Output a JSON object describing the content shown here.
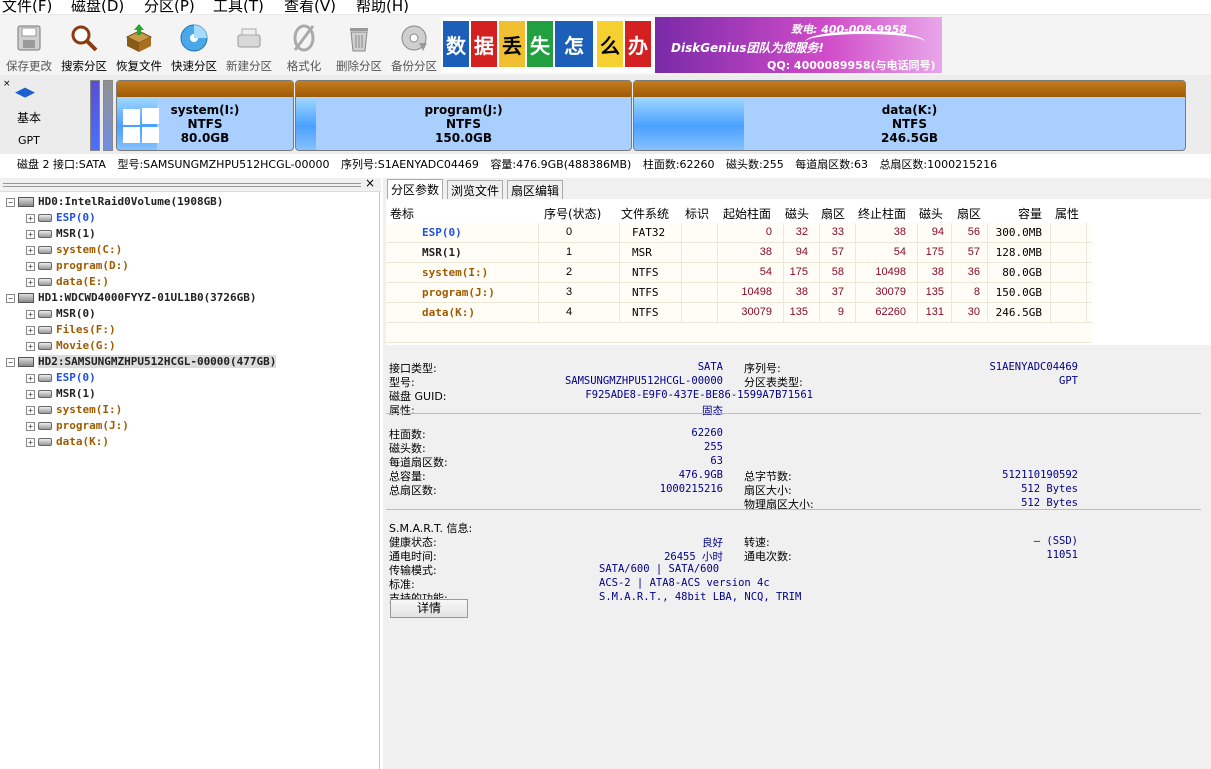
{
  "menu": [
    "文件(F)",
    "磁盘(D)",
    "分区(P)",
    "工具(T)",
    "查看(V)",
    "帮助(H)"
  ],
  "toolbar": [
    {
      "label": "保存更改",
      "icon": "save-disk-icon",
      "enabled": false
    },
    {
      "label": "搜索分区",
      "icon": "magnifier-icon",
      "enabled": true
    },
    {
      "label": "恢复文件",
      "icon": "recover-box-icon",
      "enabled": true
    },
    {
      "label": "快速分区",
      "icon": "quick-partition-disc-icon",
      "enabled": true
    },
    {
      "label": "新建分区",
      "icon": "new-partition-icon",
      "enabled": false
    },
    {
      "label": "格式化",
      "icon": "format-icon",
      "enabled": false
    },
    {
      "label": "删除分区",
      "icon": "trash-icon",
      "enabled": false
    },
    {
      "label": "备份分区",
      "icon": "backup-disc-icon",
      "enabled": false
    }
  ],
  "banner": {
    "tiles": [
      "数",
      "据",
      "丢",
      "失",
      "怎",
      "么",
      "办"
    ],
    "brand": "DiskGenius团队为您服务!",
    "tel": "致电: 400-008-9958",
    "qq": "QQ: 4000089958(与电话同号)"
  },
  "diskmap": {
    "mode": "基本",
    "table": "GPT",
    "partitions": [
      {
        "name": "system(I:)",
        "fs": "NTFS",
        "size": "80.0GB",
        "fill": 0.23
      },
      {
        "name": "program(J:)",
        "fs": "NTFS",
        "size": "150.0GB",
        "fill": 0.06
      },
      {
        "name": "data(K:)",
        "fs": "NTFS",
        "size": "246.5GB",
        "fill": 0.2
      }
    ],
    "info": [
      "磁盘 2 接口:SATA",
      "型号:SAMSUNGMZHPU512HCGL-00000",
      "序列号:S1AENYADC04469",
      "容量:476.9GB(488386MB)",
      "柱面数:62260",
      "磁头数:255",
      "每道扇区数:63",
      "总扇区数:1000215216"
    ]
  },
  "tree": [
    {
      "level": 0,
      "text": "HD0:IntelRaid0Volume(1908GB)",
      "color": "black"
    },
    {
      "level": 1,
      "text": "ESP(0)",
      "color": "blue"
    },
    {
      "level": 1,
      "text": "MSR(1)",
      "color": "black"
    },
    {
      "level": 1,
      "text": "system(C:)",
      "color": "brown"
    },
    {
      "level": 1,
      "text": "program(D:)",
      "color": "brown"
    },
    {
      "level": 1,
      "text": "data(E:)",
      "color": "brown"
    },
    {
      "level": 0,
      "text": "HD1:WDCWD4000FYYZ-01UL1B0(3726GB)",
      "color": "black"
    },
    {
      "level": 1,
      "text": "MSR(0)",
      "color": "black"
    },
    {
      "level": 1,
      "text": "Files(F:)",
      "color": "brown"
    },
    {
      "level": 1,
      "text": "Movie(G:)",
      "color": "brown"
    },
    {
      "level": 0,
      "text": "HD2:SAMSUNGMZHPU512HCGL-00000(477GB)",
      "color": "black",
      "selected": true
    },
    {
      "level": 1,
      "text": "ESP(0)",
      "color": "blue"
    },
    {
      "level": 1,
      "text": "MSR(1)",
      "color": "black"
    },
    {
      "level": 1,
      "text": "system(I:)",
      "color": "brown"
    },
    {
      "level": 1,
      "text": "program(J:)",
      "color": "brown"
    },
    {
      "level": 1,
      "text": "data(K:)",
      "color": "brown"
    }
  ],
  "tabs": [
    "分区参数",
    "浏览文件",
    "扇区编辑"
  ],
  "table": {
    "headers": [
      "卷标",
      "序号(状态)",
      "文件系统",
      "标识",
      "起始柱面",
      "磁头",
      "扇区",
      "终止柱面",
      "磁头",
      "扇区",
      "容量",
      "属性"
    ],
    "rows": [
      {
        "label": "ESP(0)",
        "color": "blue",
        "idx": "0",
        "fs": "FAT32",
        "id": "",
        "sc": "0",
        "sh": "32",
        "ss": "33",
        "ec": "38",
        "eh": "94",
        "es": "56",
        "cap": "300.0MB",
        "attr": ""
      },
      {
        "label": "MSR(1)",
        "color": "black",
        "idx": "1",
        "fs": "MSR",
        "id": "",
        "sc": "38",
        "sh": "94",
        "ss": "57",
        "ec": "54",
        "eh": "175",
        "es": "57",
        "cap": "128.0MB",
        "attr": ""
      },
      {
        "label": "system(I:)",
        "color": "brown",
        "idx": "2",
        "fs": "NTFS",
        "id": "",
        "sc": "54",
        "sh": "175",
        "ss": "58",
        "ec": "10498",
        "eh": "38",
        "es": "36",
        "cap": "80.0GB",
        "attr": ""
      },
      {
        "label": "program(J:)",
        "color": "brown",
        "idx": "3",
        "fs": "NTFS",
        "id": "",
        "sc": "10498",
        "sh": "38",
        "ss": "37",
        "ec": "30079",
        "eh": "135",
        "es": "8",
        "cap": "150.0GB",
        "attr": ""
      },
      {
        "label": "data(K:)",
        "color": "brown",
        "idx": "4",
        "fs": "NTFS",
        "id": "",
        "sc": "30079",
        "sh": "135",
        "ss": "9",
        "ec": "62260",
        "eh": "131",
        "es": "30",
        "cap": "246.5GB",
        "attr": ""
      }
    ]
  },
  "info": {
    "iface_label": "接口类型:",
    "iface": "SATA",
    "serial_label": "序列号:",
    "serial": "S1AENYADC04469",
    "model_label": "型号:",
    "model": "SAMSUNGMZHPU512HCGL-00000",
    "pttype_label": "分区表类型:",
    "pttype": "GPT",
    "guid_label": "磁盘 GUID:",
    "guid": "F925ADE8-E9F0-437E-BE86-1599A7B71561",
    "attr_label": "属性:",
    "attr": "固态",
    "cyl_label": "柱面数:",
    "cyl": "62260",
    "heads_label": "磁头数:",
    "heads": "255",
    "spt_label": "每道扇区数:",
    "spt": "63",
    "cap_label": "总容量:",
    "cap": "476.9GB",
    "bytes_label": "总字节数:",
    "bytes": "512110190592",
    "sectors_label": "总扇区数:",
    "sectors": "1000215216",
    "secsize_label": "扇区大小:",
    "secsize": "512 Bytes",
    "physsec_label": "物理扇区大小:",
    "physsec": "512 Bytes",
    "smart_label": "S.M.A.R.T. 信息:",
    "health_label": "健康状态:",
    "health": "良好",
    "rpm_label": "转速:",
    "rpm": "— (SSD)",
    "hours_label": "通电时间:",
    "hours": "26455 小时",
    "count_label": "通电次数:",
    "count": "11051",
    "mode_label": "传输模式:",
    "mode": "SATA/600 | SATA/600",
    "std_label": "标准:",
    "std": "ACS-2 | ATA8-ACS version 4c",
    "feat_label": "支持的功能:",
    "feat": "S.M.A.R.T., 48bit LBA, NCQ, TRIM",
    "details_button": "详情"
  }
}
